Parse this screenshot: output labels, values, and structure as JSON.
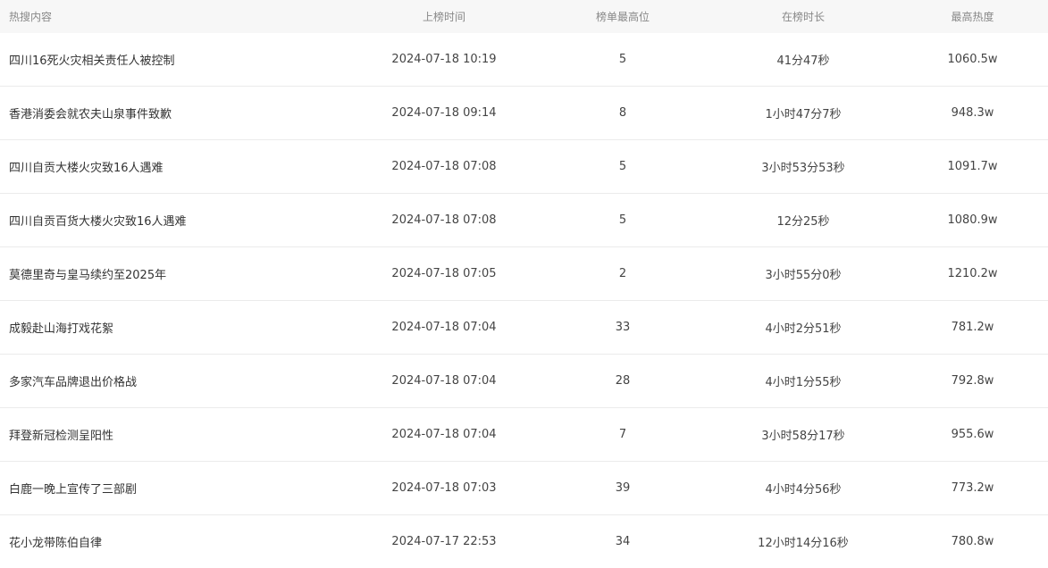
{
  "table": {
    "headers": {
      "title": "热搜内容",
      "time": "上榜时间",
      "rank": "榜单最高位",
      "duration": "在榜时长",
      "heat": "最高热度"
    },
    "rows": [
      {
        "title": "四川16死火灾相关责任人被控制",
        "time": "2024-07-18 10:19",
        "rank": "5",
        "duration": "41分47秒",
        "heat": "1060.5w"
      },
      {
        "title": "香港消委会就农夫山泉事件致歉",
        "time": "2024-07-18 09:14",
        "rank": "8",
        "duration": "1小时47分7秒",
        "heat": "948.3w"
      },
      {
        "title": "四川自贡大楼火灾致16人遇难",
        "time": "2024-07-18 07:08",
        "rank": "5",
        "duration": "3小时53分53秒",
        "heat": "1091.7w"
      },
      {
        "title": "四川自贡百货大楼火灾致16人遇难",
        "time": "2024-07-18 07:08",
        "rank": "5",
        "duration": "12分25秒",
        "heat": "1080.9w"
      },
      {
        "title": "莫德里奇与皇马续约至2025年",
        "time": "2024-07-18 07:05",
        "rank": "2",
        "duration": "3小时55分0秒",
        "heat": "1210.2w"
      },
      {
        "title": "成毅赴山海打戏花絮",
        "time": "2024-07-18 07:04",
        "rank": "33",
        "duration": "4小时2分51秒",
        "heat": "781.2w"
      },
      {
        "title": "多家汽车品牌退出价格战",
        "time": "2024-07-18 07:04",
        "rank": "28",
        "duration": "4小时1分55秒",
        "heat": "792.8w"
      },
      {
        "title": "拜登新冠检测呈阳性",
        "time": "2024-07-18 07:04",
        "rank": "7",
        "duration": "3小时58分17秒",
        "heat": "955.6w"
      },
      {
        "title": "白鹿一晚上宣传了三部剧",
        "time": "2024-07-18 07:03",
        "rank": "39",
        "duration": "4小时4分56秒",
        "heat": "773.2w"
      },
      {
        "title": "花小龙带陈伯自律",
        "time": "2024-07-17 22:53",
        "rank": "34",
        "duration": "12小时14分16秒",
        "heat": "780.8w"
      }
    ]
  }
}
